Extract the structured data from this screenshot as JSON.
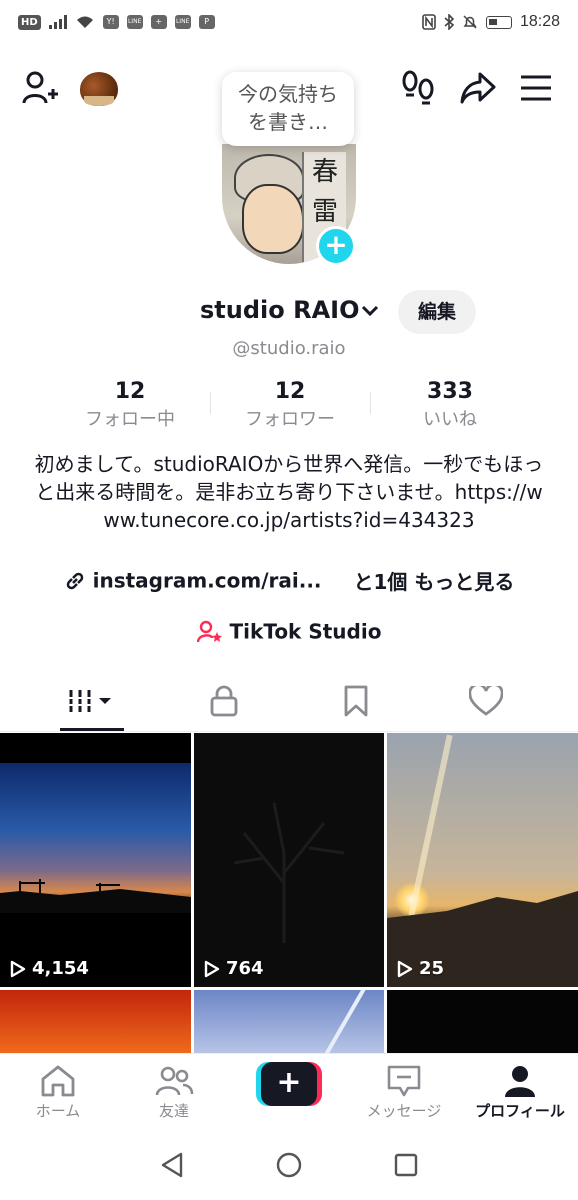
{
  "status_bar": {
    "network_label": "HD",
    "time": "18:28",
    "notif_icons": [
      "Y!",
      "LINE",
      "+",
      "LINE",
      "P"
    ]
  },
  "top_bar": {
    "add_friend_icon": "person-plus-icon",
    "emoji_icon": "chestnut-icon",
    "footprints_icon": "footprints-icon",
    "share_icon": "share-arrow-icon",
    "menu_icon": "hamburger-menu-icon"
  },
  "profile": {
    "note_bubble": "今の気持ちを書き…",
    "name": "studio RAIO",
    "edit_label": "編集",
    "handle": "@studio.raio",
    "avatar_sign_text": "春雷",
    "stats": [
      {
        "value": "12",
        "label": "フォロー中"
      },
      {
        "value": "12",
        "label": "フォロワー"
      },
      {
        "value": "333",
        "label": "いいね"
      }
    ],
    "bio": "初めまして。studioRAIOから世界へ発信。一秒でもほっと出来る時間を。是非お立ち寄り下さいませ。https://www.tunecore.co.jp/artists?id=434323",
    "link_text": "instagram.com/rai...",
    "link_more": "と1個 もっと見る",
    "studio_label": "TikTok Studio"
  },
  "tabs": [
    {
      "name": "videos-tab",
      "icon": "grid-lines-icon",
      "active": true
    },
    {
      "name": "private-tab",
      "icon": "lock-icon",
      "active": false
    },
    {
      "name": "saved-tab",
      "icon": "bookmark-icon",
      "active": false
    },
    {
      "name": "liked-tab",
      "icon": "heart-icon",
      "active": false
    }
  ],
  "videos": [
    {
      "views": "4,154"
    },
    {
      "views": "764"
    },
    {
      "views": "25"
    }
  ],
  "bottom_nav": {
    "home": "ホーム",
    "friends": "友達",
    "inbox": "メッセージ",
    "profile": "プロフィール"
  },
  "colors": {
    "accent_cyan": "#20d5ec",
    "accent_red": "#fe2c55",
    "text_primary": "#161823",
    "text_secondary": "#8a8b91"
  }
}
